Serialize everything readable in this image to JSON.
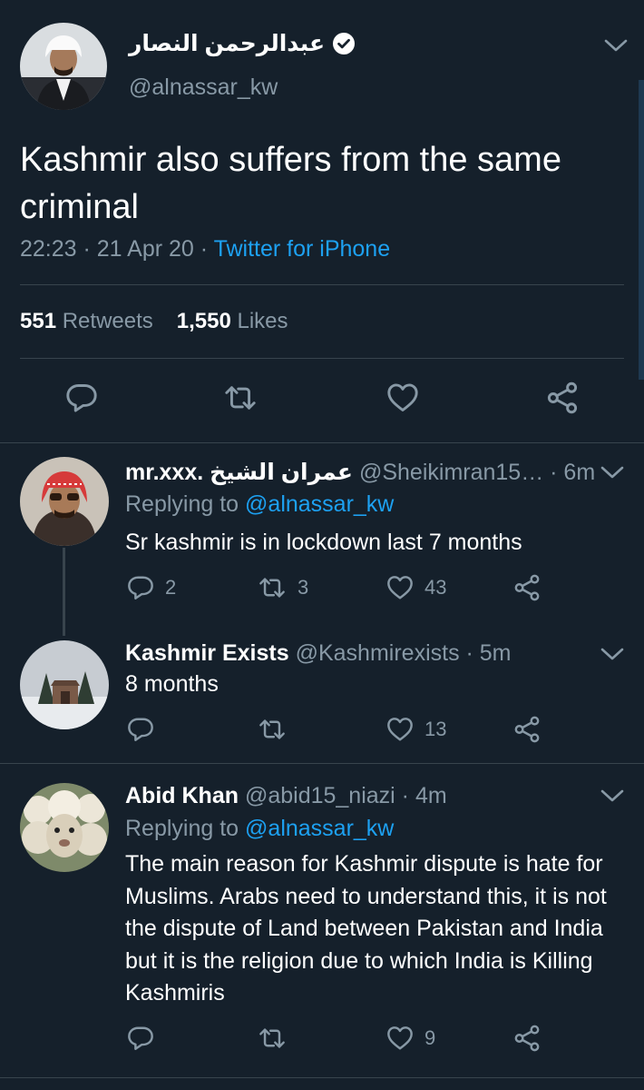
{
  "main_tweet": {
    "author_name": "عبدالرحمن النصار",
    "verified": true,
    "handle": "@alnassar_kw",
    "text": "Kashmir also suffers from the same criminal",
    "time": "22:23 · 21 Apr 20 · ",
    "source": "Twitter for iPhone",
    "retweets_count": "551",
    "retweets_label": "Retweets",
    "likes_count": "1,550",
    "likes_label": "Likes"
  },
  "replies": [
    {
      "name": "mr.xxx. عمران الشيخ",
      "handle_time": "@Sheikimran15…  · 6m",
      "replying_prefix": "Replying to ",
      "replying_to": "@alnassar_kw",
      "text": "Sr kashmir is in lockdown last 7 months",
      "reply_count": "2",
      "retweet_count": "3",
      "like_count": "43"
    },
    {
      "name": "Kashmir Exists",
      "handle_time": "@Kashmirexists · 5m",
      "text": "8 months",
      "reply_count": "",
      "retweet_count": "",
      "like_count": "13"
    },
    {
      "name": "Abid Khan",
      "handle_time": "@abid15_niazi · 4m",
      "replying_prefix": "Replying to ",
      "replying_to": "@alnassar_kw",
      "text": "The main reason for Kashmir dispute is hate for Muslims. Arabs need to understand this, it is not the dispute of Land between Pakistan and India but it is the religion due to which India is Killing Kashmiris",
      "reply_count": "",
      "retweet_count": "",
      "like_count": "9"
    }
  ],
  "icons": {
    "reply": "reply-icon",
    "retweet": "retweet-icon",
    "like": "heart-icon",
    "share": "share-icon",
    "more": "chevron-down-icon",
    "verified": "verified-badge-icon"
  },
  "colors": {
    "background": "#15202b",
    "divider": "#38444d",
    "muted_text": "#8899a6",
    "link": "#1da1f2",
    "text": "#ffffff"
  }
}
